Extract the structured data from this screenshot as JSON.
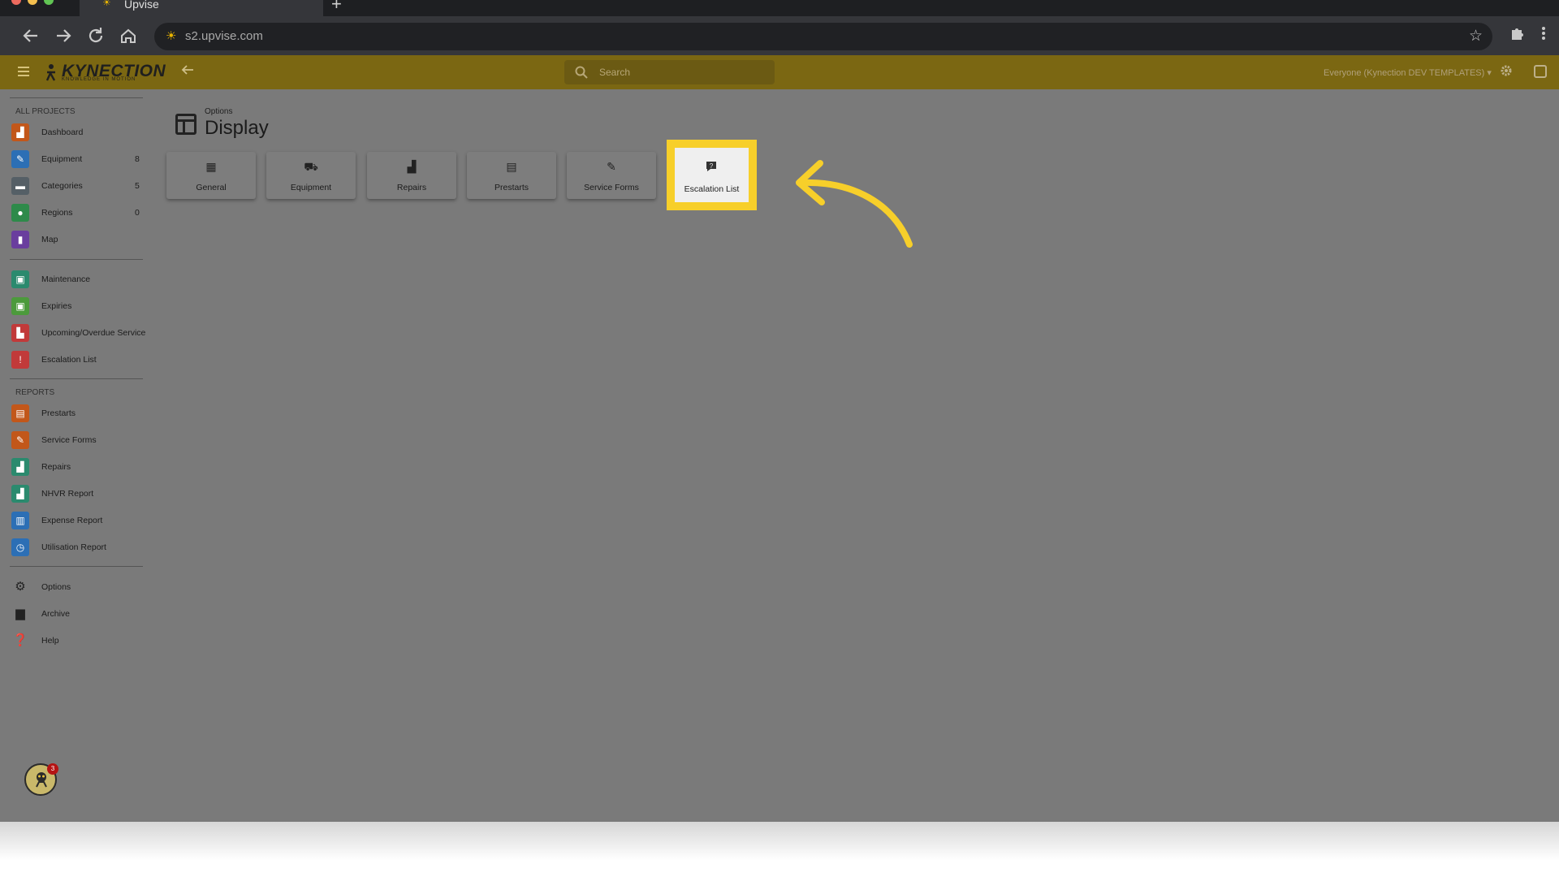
{
  "browser": {
    "tab_title": "Upvise",
    "url": "s2.upvise.com"
  },
  "appbar": {
    "logo_text": "KYNECTION",
    "logo_tagline": "KNOWLEDGE IN MOTION",
    "search_placeholder": "Search",
    "scope": "Everyone (Kynection DEV TEMPLATES)"
  },
  "sidebar": {
    "section_all": "ALL PROJECTS",
    "section_reports": "REPORTS",
    "group1": [
      {
        "label": "Dashboard",
        "count": "",
        "icon": "dashboard-icon",
        "color": "#c2571a"
      },
      {
        "label": "Equipment",
        "count": "8",
        "icon": "wrench-icon",
        "color": "#2c6fb5"
      },
      {
        "label": "Categories",
        "count": "5",
        "icon": "folder-icon",
        "color": "#555f66"
      },
      {
        "label": "Regions",
        "count": "0",
        "icon": "pin-icon",
        "color": "#2e8a4a"
      },
      {
        "label": "Map",
        "count": "",
        "icon": "map-icon",
        "color": "#6a3e9e"
      }
    ],
    "group2": [
      {
        "label": "Maintenance",
        "icon": "calendar-icon",
        "color": "#2b8a6e"
      },
      {
        "label": "Expiries",
        "icon": "calendar-icon",
        "color": "#4c9a3c"
      },
      {
        "label": "Upcoming/Overdue Service",
        "icon": "service-icon",
        "color": "#c13a3a"
      },
      {
        "label": "Escalation List",
        "icon": "escalation-icon",
        "color": "#c13a3a"
      }
    ],
    "group3": [
      {
        "label": "Prestarts",
        "icon": "document-icon",
        "color": "#c2571a"
      },
      {
        "label": "Service Forms",
        "icon": "wrench-icon",
        "color": "#c2571a"
      },
      {
        "label": "Repairs",
        "icon": "chart-icon",
        "color": "#2b8a6e"
      },
      {
        "label": "NHVR Report",
        "icon": "chart-icon",
        "color": "#2b8a6e"
      },
      {
        "label": "Expense Report",
        "icon": "bar-chart-icon",
        "color": "#2c6fb5"
      },
      {
        "label": "Utilisation Report",
        "icon": "clock-icon",
        "color": "#2c6fb5"
      }
    ],
    "group4": [
      {
        "label": "Options",
        "icon": "gear-icon"
      },
      {
        "label": "Archive",
        "icon": "archive-icon"
      },
      {
        "label": "Help",
        "icon": "help-icon"
      }
    ],
    "notification_count": "3"
  },
  "main": {
    "breadcrumb": "Options",
    "title": "Display",
    "tiles": [
      {
        "label": "General",
        "icon": "table-icon"
      },
      {
        "label": "Equipment",
        "icon": "truck-icon"
      },
      {
        "label": "Repairs",
        "icon": "chart-icon"
      },
      {
        "label": "Prestarts",
        "icon": "document-icon"
      },
      {
        "label": "Service Forms",
        "icon": "wrench-icon"
      },
      {
        "label": "Escalation List",
        "icon": "escalation-icon"
      }
    ]
  },
  "colors": {
    "highlight": "#f7cf2a",
    "appbar": "#7b6712"
  }
}
